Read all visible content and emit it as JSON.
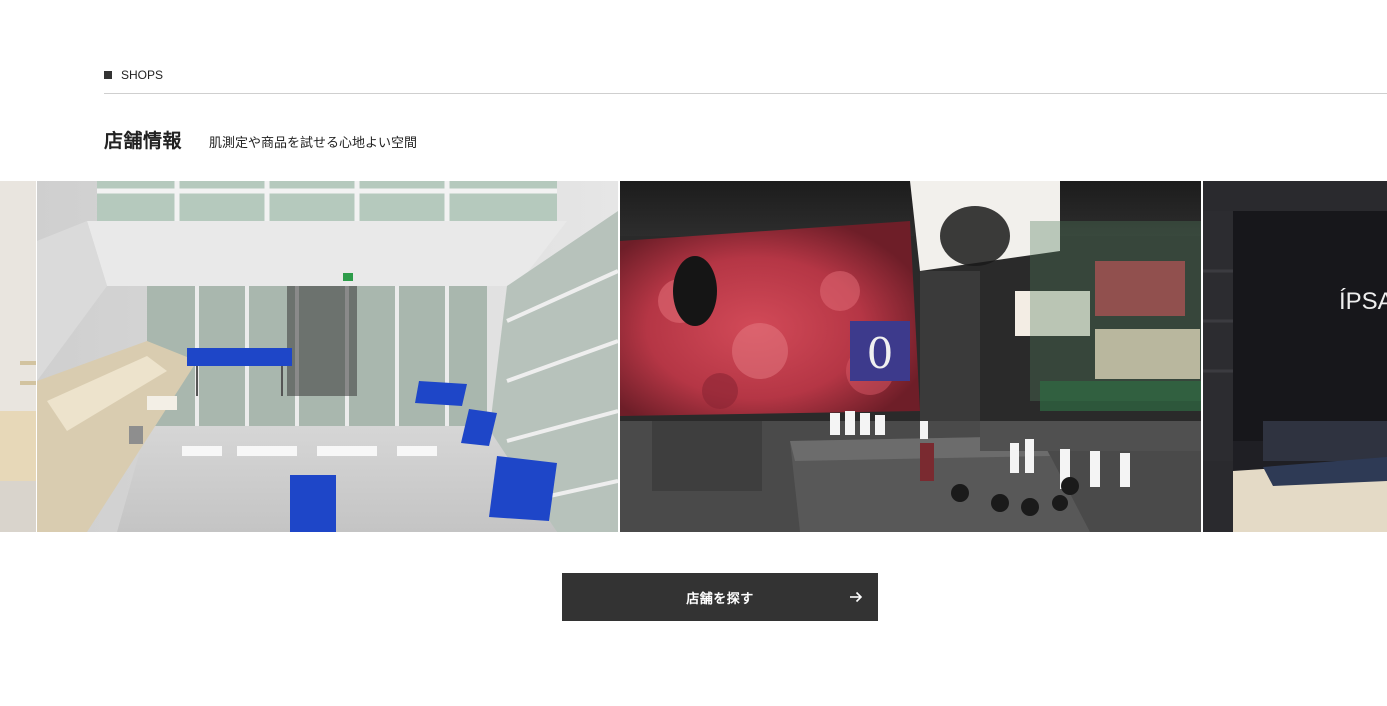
{
  "section": {
    "label": "SHOPS"
  },
  "heading": {
    "title": "店舗情報",
    "subtitle": "肌測定や商品を試せる心地よい空間"
  },
  "carousel": {
    "slides": [
      {
        "name": "shop-photo-partial-left"
      },
      {
        "name": "shop-photo-atrium"
      },
      {
        "name": "shop-photo-flower-wall"
      },
      {
        "name": "shop-photo-ipsa-counter",
        "logo_text": "ÍPSA"
      }
    ]
  },
  "cta": {
    "label": "店舗を探す",
    "icon": "arrow-right-icon"
  },
  "colors": {
    "button_bg": "#333333",
    "accent_blue": "#1e46c8",
    "flower_red": "#c83c4a"
  }
}
